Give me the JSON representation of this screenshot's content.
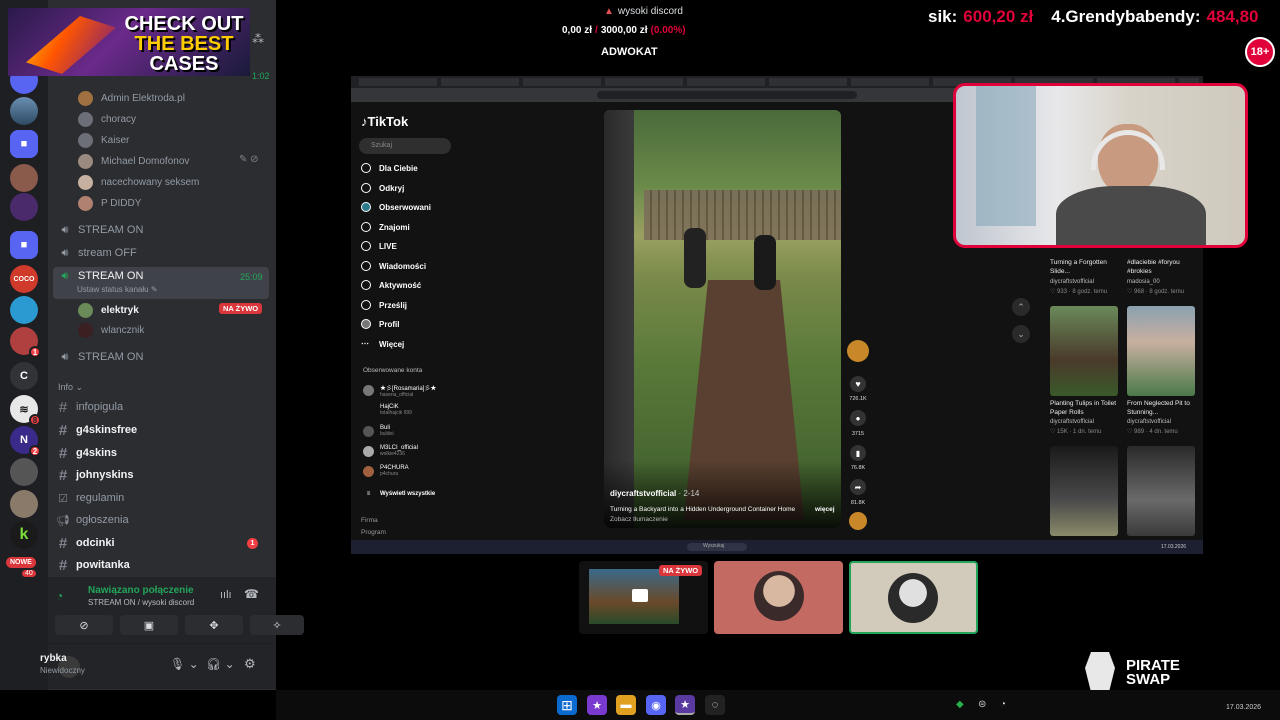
{
  "window": {
    "title": "wysoki discord"
  },
  "overlay": {
    "promo_line1": "CHECK OUT",
    "promo_line2": "THE BEST",
    "promo_line3": "CASES",
    "money_current": "0,00 zł",
    "money_sep": "/",
    "money_goal": "3000,00 zł",
    "money_pct": "(0.00%)",
    "goal_label": "ADWOKAT",
    "donor1_name": "sik:",
    "donor1_amount": "600,20 zł",
    "donor2_name": "4.Grendybabendy:",
    "donor2_amount": "484,80",
    "age_badge": "18+",
    "brand_line1": "PIRATE",
    "brand_line2": "SWAP"
  },
  "sidebar": {
    "top_time": "1:02",
    "voice_users_top": [
      "Admin Elektroda.pl",
      "choracy",
      "Kaiser",
      "Michael Domofonov",
      "nacechowany seksem",
      "P DIDDY"
    ],
    "channels": {
      "stream_on_1": "STREAM ON",
      "stream_off": "stream OFF",
      "stream_on_active": "STREAM ON",
      "stream_on_active_time": "25:09",
      "stream_status": "Ustaw status kanału",
      "live_user": "elektryk",
      "live_badge": "NA ŻYWO",
      "user2": "wlancznik",
      "stream_on_3": "STREAM ON"
    },
    "category": "Info",
    "text_channels": [
      {
        "name": "infopigula",
        "bright": false
      },
      {
        "name": "g4skinsfree",
        "bright": true
      },
      {
        "name": "g4skins",
        "bright": true
      },
      {
        "name": "johnyskins",
        "bright": true
      },
      {
        "name": "regulamin",
        "bright": false
      },
      {
        "name": "ogłoszenia",
        "bright": false
      },
      {
        "name": "odcinki",
        "bright": true
      },
      {
        "name": "powitanka",
        "bright": true
      }
    ],
    "odcinki_badge": "1"
  },
  "rail": {
    "new_badge": "NOWE",
    "badges": [
      "8",
      "2",
      "1",
      "40"
    ],
    "letter_server": "C"
  },
  "voice_panel": {
    "status": "Nawiązano połączenie",
    "channel": "STREAM ON / wysoki discord"
  },
  "user_panel": {
    "username": "rybka",
    "status": "Niewidoczny"
  },
  "tiktok": {
    "logo": "TikTok",
    "search_placeholder": "Szukaj",
    "nav": [
      "Dla Ciebie",
      "Odkryj",
      "Obserwowani",
      "Znajomi",
      "LIVE",
      "Wiadomości",
      "Aktywność",
      "Prześlij",
      "Profil",
      "Więcej"
    ],
    "followed_title": "Obserwowane konta",
    "followed": [
      {
        "name": "★彡[Rosamaria]彡★",
        "handle": "hasena_official"
      },
      {
        "name": "HajCiK",
        "handle": "totalhajcik 999"
      },
      {
        "name": "Buli",
        "handle": "buliiixi"
      },
      {
        "name": "M3LCI_official",
        "handle": "wolkie4236"
      },
      {
        "name": "P4CHURA",
        "handle": "p4chura"
      }
    ],
    "show_all": "Wyświetl wszystkie",
    "footer1": "Firma",
    "footer2": "Program",
    "video_author": "diycraftstvofficial",
    "video_date": "· 2-14",
    "video_caption": "Turning a Backyard into a Hidden Underground Container Home",
    "video_translate": "Zobacz tłumaczenie",
    "video_more": "więcej",
    "likes": "726.1K",
    "comments": "3715",
    "saves": "76.8K",
    "shares": "81.8K",
    "thumbs": [
      {
        "caption": "Turning a Forgotten Slide...",
        "author": "diycraftstvofficial",
        "meta": "♡ 933 · 8 godz. temu"
      },
      {
        "caption": "#dlaciebie #foryou #brokies",
        "author": "madosia_00",
        "meta": "♡ 968 · 8 godz. temu"
      },
      {
        "caption": "Planting Tulips in Toilet Paper Rolls",
        "author": "diycraftstvofficial",
        "meta": "♡ 15K · 1 dn. temu"
      },
      {
        "caption": "From Neglected Pit to Stunning...",
        "author": "diycraftstvofficial",
        "meta": "♡ 989 · 4 dn. temu"
      }
    ],
    "taskbar_search": "Wyszukaj",
    "taskbar_date": "17.03.2026"
  },
  "tiles": {
    "live_badge": "NA ŻYWO"
  },
  "taskbar": {
    "date": "17.03.2026"
  },
  "colors": {
    "accent_red": "#e0003a",
    "discord_green": "#23a55a",
    "live_red": "#da373c"
  }
}
